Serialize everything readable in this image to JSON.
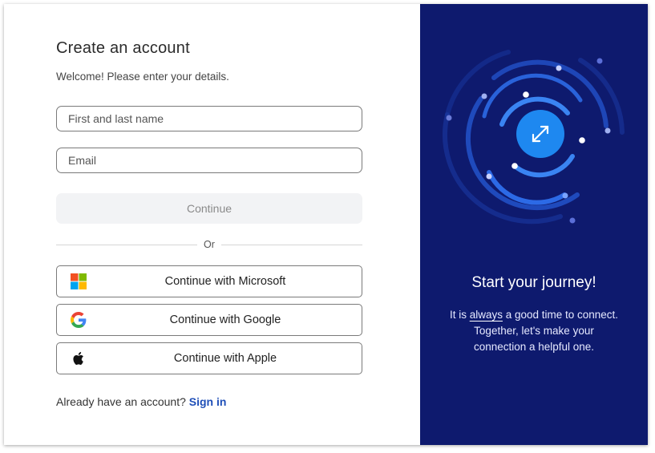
{
  "form": {
    "title": "Create an account",
    "subtitle": "Welcome! Please enter your details.",
    "name_placeholder": "First and last name",
    "email_placeholder": "Email",
    "continue_label": "Continue",
    "divider_label": "Or"
  },
  "social": {
    "microsoft_label": "Continue with Microsoft",
    "google_label": "Continue with Google",
    "apple_label": "Continue with Apple"
  },
  "signin": {
    "prompt": "Already have an account?",
    "link_label": "Sign in"
  },
  "hero": {
    "heading": "Start your journey!",
    "line1_pre": "It is ",
    "line1_em": "always",
    "line1_post": " a good time to connect.",
    "line2": "Together, let's make your",
    "line3": "connection a helpful one.",
    "center_icon": "expand-arrows-icon"
  },
  "colors": {
    "panel_bg": "#0e1a6e",
    "accent": "#1e88f0",
    "link": "#1f4fb8"
  }
}
